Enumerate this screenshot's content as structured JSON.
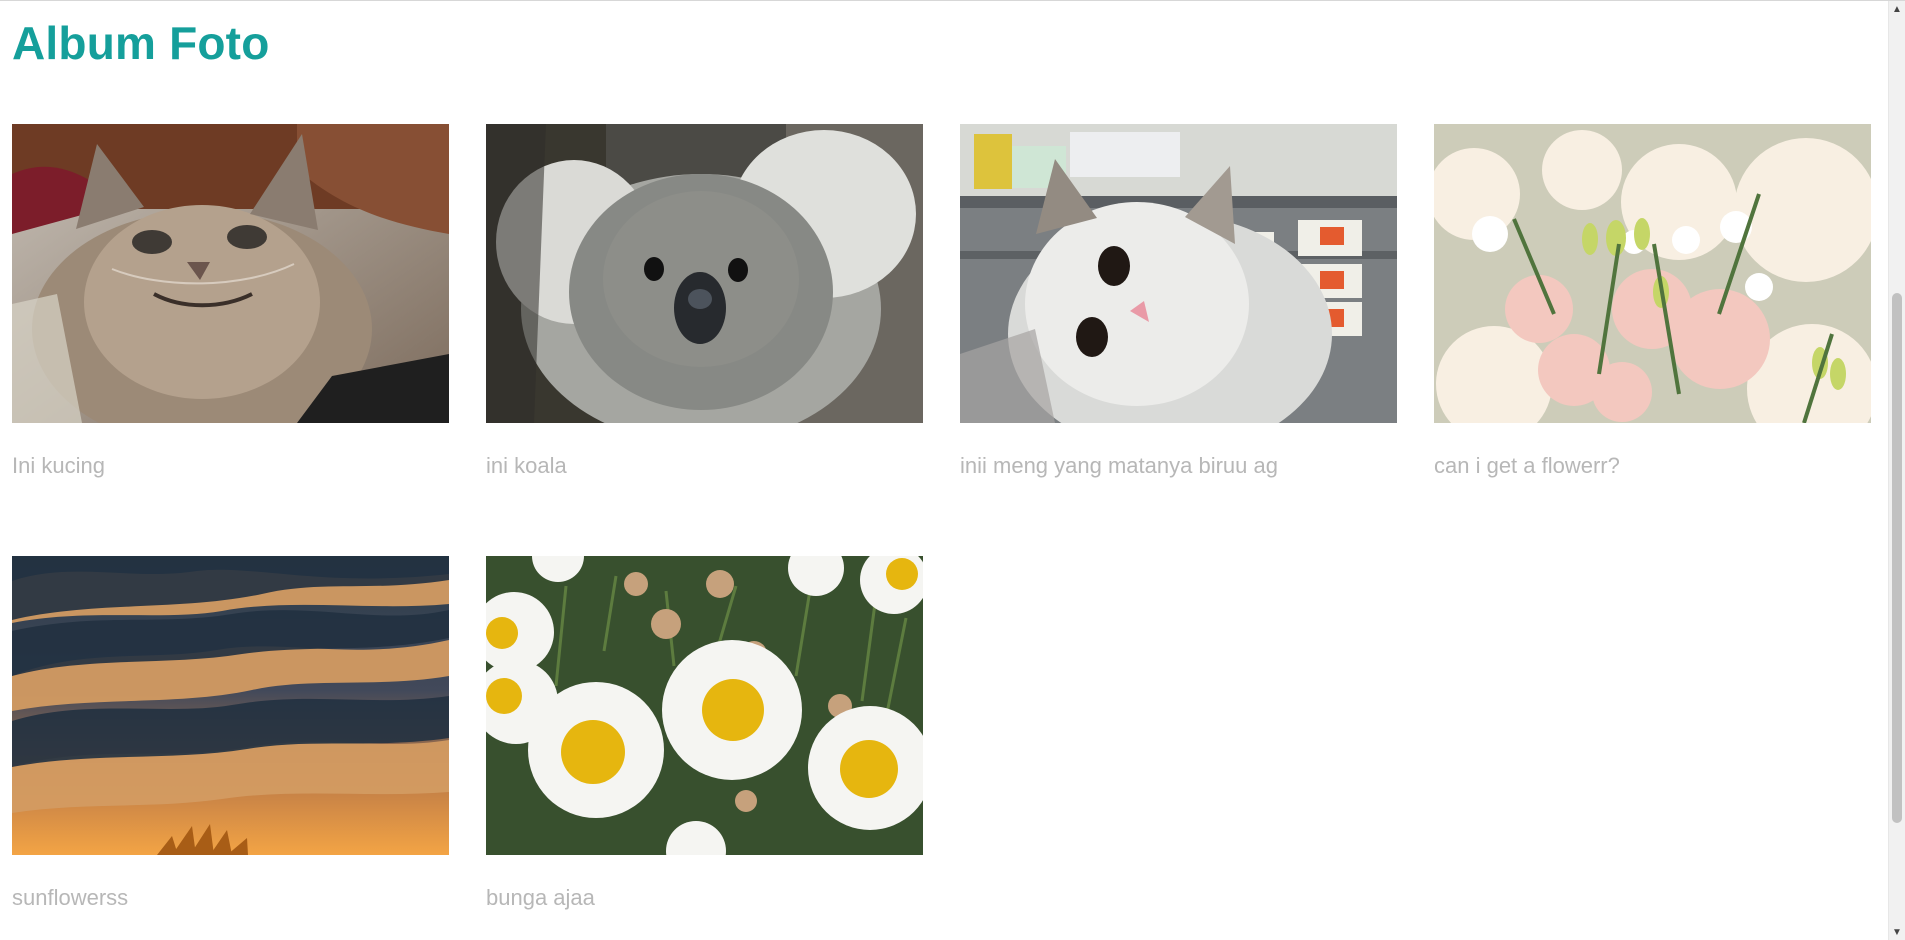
{
  "page": {
    "title": "Album Foto"
  },
  "colors": {
    "accent": "#159f9b",
    "caption": "#b7b7b7"
  },
  "gallery": {
    "items": [
      {
        "caption": "Ini kucing",
        "image": "tabby-cat-photo",
        "link": "cat-photo-link"
      },
      {
        "caption": "ini koala",
        "image": "koala-photo",
        "link": "koala-photo-link"
      },
      {
        "caption": "inii meng yang matanya biruu ag",
        "image": "white-cat-photo",
        "link": "white-cat-photo-link"
      },
      {
        "caption": "can i get a flowerr?",
        "image": "flower-bouquet-photo",
        "link": "flower-photo-link"
      },
      {
        "caption": "sunflowerss",
        "image": "sunset-sunflower-photo",
        "link": "sunflower-photo-link"
      },
      {
        "caption": "bunga ajaa",
        "image": "daisy-photo",
        "link": "daisy-photo-link"
      }
    ]
  },
  "scrollbar": {
    "up_icon": "chevron-up-icon",
    "down_icon": "chevron-down-icon"
  }
}
